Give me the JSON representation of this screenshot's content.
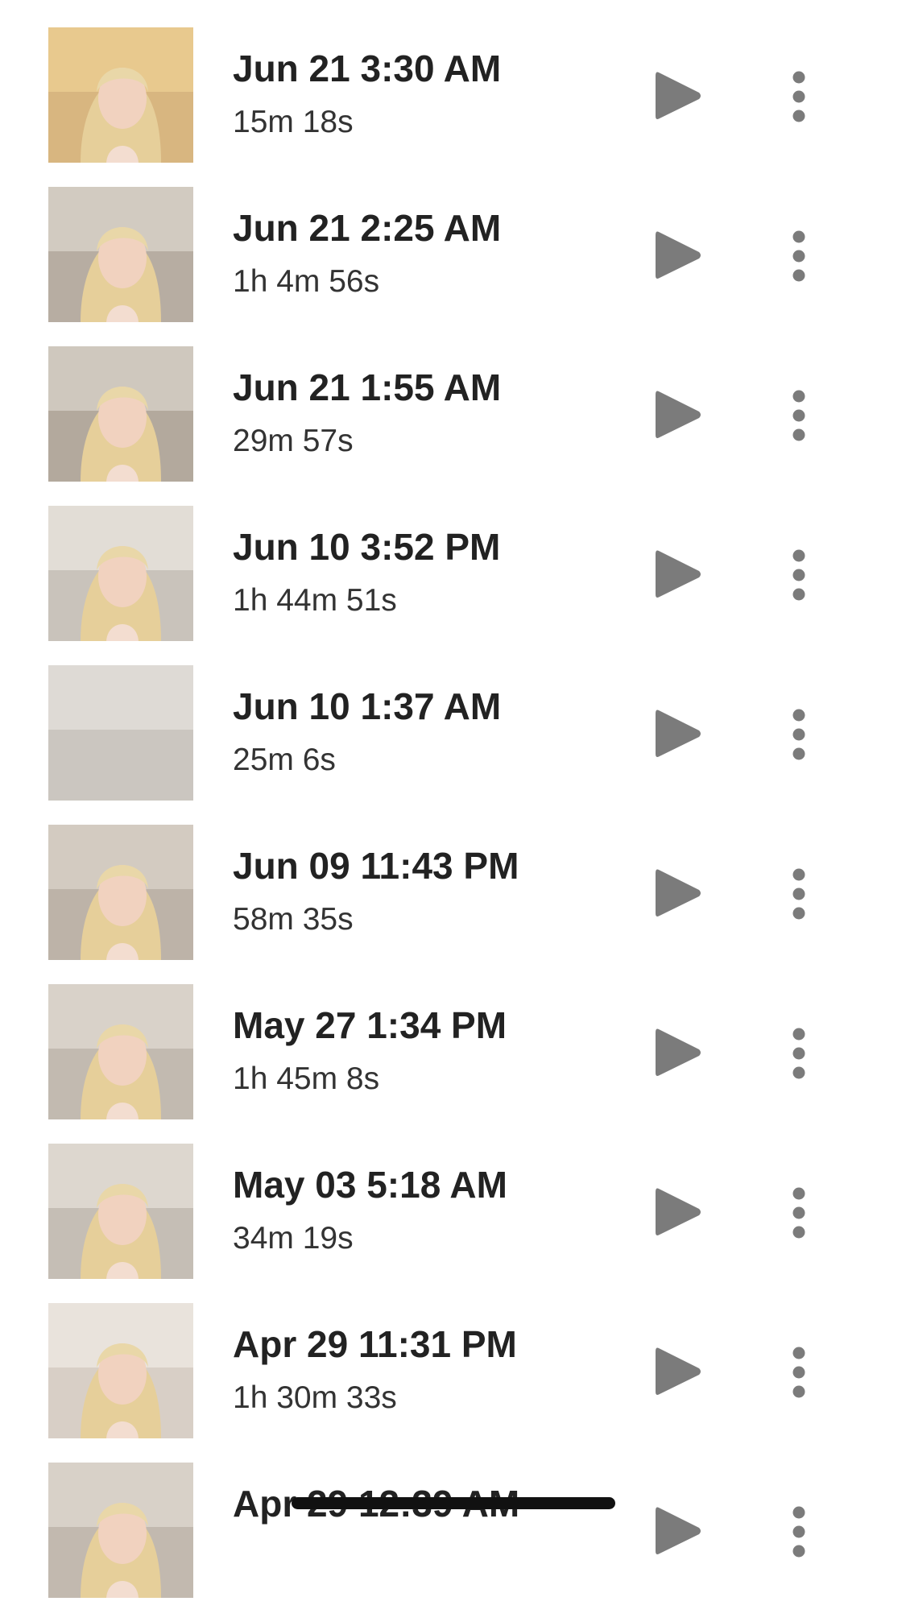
{
  "recordings": [
    {
      "title": "Jun 21 3:30 AM",
      "duration": "15m 18s",
      "bg": "#d8b680",
      "wall": "#e8c98e"
    },
    {
      "title": "Jun 21 2:25 AM",
      "duration": "1h 4m 56s",
      "bg": "#b7ada2",
      "wall": "#d2cbc1"
    },
    {
      "title": "Jun 21 1:55 AM",
      "duration": "29m 57s",
      "bg": "#b3a99d",
      "wall": "#cfc8be"
    },
    {
      "title": "Jun 10 3:52 PM",
      "duration": "1h 44m 51s",
      "bg": "#c9c3bb",
      "wall": "#e2ddd6"
    },
    {
      "title": "Jun 10 1:37 AM",
      "duration": "25m 6s",
      "bg": "#cbc6c0",
      "wall": "#dedad5"
    },
    {
      "title": "Jun 09 11:43 PM",
      "duration": "58m 35s",
      "bg": "#bdb3a8",
      "wall": "#d3cbc1"
    },
    {
      "title": "May 27 1:34 PM",
      "duration": "1h 45m 8s",
      "bg": "#c2bab0",
      "wall": "#d9d2c9"
    },
    {
      "title": "May 03 5:18 AM",
      "duration": "34m 19s",
      "bg": "#c5beb5",
      "wall": "#ddd7cf"
    },
    {
      "title": "Apr 29 11:31 PM",
      "duration": "1h 30m 33s",
      "bg": "#d8cfc6",
      "wall": "#e9e3dc"
    },
    {
      "title": "Apr 29 12:39 AM",
      "duration": "",
      "bg": "#c2b9af",
      "wall": "#d8d1c8"
    }
  ],
  "icons": {
    "play": "play-icon",
    "more": "more-vertical-icon"
  },
  "colors": {
    "icon_gray": "#7b7b7b",
    "title_text": "#222222",
    "duration_text": "#333333",
    "home_indicator": "#111111"
  }
}
